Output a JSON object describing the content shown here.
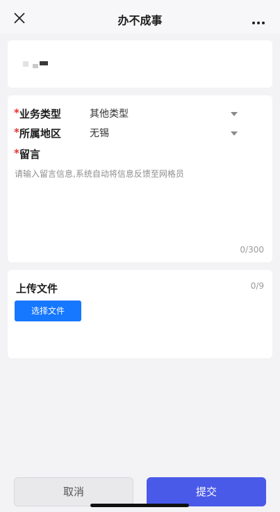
{
  "header": {
    "title": "办不成事"
  },
  "form": {
    "business_type": {
      "label": "业务类型",
      "value": "其他类型"
    },
    "region": {
      "label": "所属地区",
      "value": "无锡"
    },
    "message": {
      "label": "留言",
      "placeholder": "请输入留言信息,系统自动将信息反馈至网格员",
      "counter": "0/300"
    },
    "required_mark": "*"
  },
  "upload": {
    "title": "上传文件",
    "count": "0/9",
    "choose_label": "选择文件"
  },
  "footer": {
    "cancel_label": "取消",
    "submit_label": "提交"
  },
  "colors": {
    "primary": "#4a5ae8",
    "upload_button": "#1677ff",
    "required": "#e7312f"
  },
  "icons": {
    "close": "close-icon",
    "more": "more-dots-icon",
    "dropdown": "caret-down-icon"
  }
}
